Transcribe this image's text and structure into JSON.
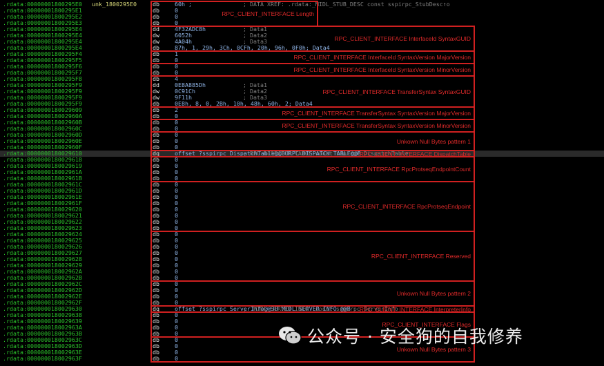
{
  "colors": {
    "background": "#000000",
    "address": "#2bc22b",
    "annotation": "#e02a2a",
    "box": "#d02020"
  },
  "lines": [
    {
      "addr": ".rdata:00000001800295E0",
      "label": "unk_1800295E0",
      "mnem": "db",
      "operand": "60h ;",
      "comment": "; DATA XREF: .rdata:_MIDL_STUB_DESC const sspirpc_StubDesc↑o"
    },
    {
      "addr": ".rdata:00000001800295E1",
      "mnem": "db",
      "operand": "0"
    },
    {
      "addr": ".rdata:00000001800295E2",
      "mnem": "db",
      "operand": "0"
    },
    {
      "addr": ".rdata:00000001800295E3",
      "mnem": "db",
      "operand": "0"
    },
    {
      "addr": ".rdata:00000001800295E4",
      "mnem": "dd",
      "operand": "4F32ADC8h",
      "comment": "; Data1"
    },
    {
      "addr": ".rdata:00000001800295E4",
      "mnem": "dw",
      "operand": "6052h",
      "comment": "; Data2"
    },
    {
      "addr": ".rdata:00000001800295E4",
      "mnem": "dw",
      "operand": "4A04h",
      "comment": "; Data3"
    },
    {
      "addr": ".rdata:00000001800295E4",
      "mnem": "db",
      "operand": "87h, 1, 29h, 3Ch, 0CFh, 20h, 96h, 0F0h; Data4"
    },
    {
      "addr": ".rdata:00000001800295F4",
      "mnem": "db",
      "operand": "1"
    },
    {
      "addr": ".rdata:00000001800295F5",
      "mnem": "db",
      "operand": "0"
    },
    {
      "addr": ".rdata:00000001800295F6",
      "mnem": "db",
      "operand": "0"
    },
    {
      "addr": ".rdata:00000001800295F7",
      "mnem": "db",
      "operand": "0"
    },
    {
      "addr": ".rdata:00000001800295F8",
      "mnem": "db",
      "operand": "4"
    },
    {
      "addr": ".rdata:00000001800295F9",
      "mnem": "dd",
      "operand": "0E8A885Dh",
      "comment": "; Data1"
    },
    {
      "addr": ".rdata:00000001800295F9",
      "mnem": "dw",
      "operand": "0C91Ch",
      "comment": "; Data2"
    },
    {
      "addr": ".rdata:00000001800295F9",
      "mnem": "dw",
      "operand": "9F11h",
      "comment": "; Data3"
    },
    {
      "addr": ".rdata:00000001800295F9",
      "mnem": "db",
      "operand": "0E8h, 8, 0, 2Bh, 10h, 48h, 60h, 2; Data4"
    },
    {
      "addr": ".rdata:0000000180029609",
      "mnem": "db",
      "operand": "2"
    },
    {
      "addr": ".rdata:000000018002960A",
      "mnem": "db",
      "operand": "0"
    },
    {
      "addr": ".rdata:000000018002960B",
      "mnem": "db",
      "operand": "0"
    },
    {
      "addr": ".rdata:000000018002960C",
      "mnem": "db",
      "operand": "0"
    },
    {
      "addr": ".rdata:000000018002960D",
      "mnem": "db",
      "operand": "0"
    },
    {
      "addr": ".rdata:000000018002960E",
      "mnem": "db",
      "operand": "0"
    },
    {
      "addr": ".rdata:000000018002960F",
      "mnem": "db",
      "operand": "0"
    },
    {
      "addr": ".rdata:0000000180029610",
      "mnem": "dq",
      "operand": "offset ?sspirpc_DispatchTable@@3URPC_DISPATCH_TABLE@@B",
      "comment": "; RPC_DISPATCH_TABLE const sspirpc_DispatchTable",
      "highlight": true
    },
    {
      "addr": ".rdata:0000000180029618",
      "mnem": "db",
      "operand": "0"
    },
    {
      "addr": ".rdata:0000000180029619",
      "mnem": "db",
      "operand": "0"
    },
    {
      "addr": ".rdata:000000018002961A",
      "mnem": "db",
      "operand": "0"
    },
    {
      "addr": ".rdata:000000018002961B",
      "mnem": "db",
      "operand": "0"
    },
    {
      "addr": ".rdata:000000018002961C",
      "mnem": "db",
      "operand": "0"
    },
    {
      "addr": ".rdata:000000018002961D",
      "mnem": "db",
      "operand": "0"
    },
    {
      "addr": ".rdata:000000018002961E",
      "mnem": "db",
      "operand": "0"
    },
    {
      "addr": ".rdata:000000018002961F",
      "mnem": "db",
      "operand": "0"
    },
    {
      "addr": ".rdata:0000000180029620",
      "mnem": "db",
      "operand": "0"
    },
    {
      "addr": ".rdata:0000000180029621",
      "mnem": "db",
      "operand": "0"
    },
    {
      "addr": ".rdata:0000000180029622",
      "mnem": "db",
      "operand": "0"
    },
    {
      "addr": ".rdata:0000000180029623",
      "mnem": "db",
      "operand": "0"
    },
    {
      "addr": ".rdata:0000000180029624",
      "mnem": "db",
      "operand": "0"
    },
    {
      "addr": ".rdata:0000000180029625",
      "mnem": "db",
      "operand": "0"
    },
    {
      "addr": ".rdata:0000000180029626",
      "mnem": "db",
      "operand": "0"
    },
    {
      "addr": ".rdata:0000000180029627",
      "mnem": "db",
      "operand": "0"
    },
    {
      "addr": ".rdata:0000000180029628",
      "mnem": "db",
      "operand": "0"
    },
    {
      "addr": ".rdata:0000000180029629",
      "mnem": "db",
      "operand": "0"
    },
    {
      "addr": ".rdata:000000018002962A",
      "mnem": "db",
      "operand": "0"
    },
    {
      "addr": ".rdata:000000018002962B",
      "mnem": "db",
      "operand": "0"
    },
    {
      "addr": ".rdata:000000018002962C",
      "mnem": "db",
      "operand": "0"
    },
    {
      "addr": ".rdata:000000018002962D",
      "mnem": "db",
      "operand": "0"
    },
    {
      "addr": ".rdata:000000018002962E",
      "mnem": "db",
      "operand": "0"
    },
    {
      "addr": ".rdata:000000018002962F",
      "mnem": "db",
      "operand": "0"
    },
    {
      "addr": ".rdata:0000000180029630",
      "mnem": "dq",
      "operand": "offset ?sspirpc_ServerInfo@@3U_MIDL_SERVER_INFO_@@B",
      "comment": "; _MIDL_SERVER_INFO_ const sspirpc_ServerInfo"
    },
    {
      "addr": ".rdata:0000000180029638",
      "mnem": "db",
      "operand": "0"
    },
    {
      "addr": ".rdata:0000000180029639",
      "mnem": "db",
      "operand": "0"
    },
    {
      "addr": ".rdata:000000018002963A",
      "mnem": "db",
      "operand": "0"
    },
    {
      "addr": ".rdata:000000018002963B",
      "mnem": "db",
      "operand": "0"
    },
    {
      "addr": ".rdata:000000018002963C",
      "mnem": "db",
      "operand": "0"
    },
    {
      "addr": ".rdata:000000018002963D",
      "mnem": "db",
      "operand": "0"
    },
    {
      "addr": ".rdata:000000018002963E",
      "mnem": "db",
      "operand": "0"
    },
    {
      "addr": ".rdata:000000018002963F",
      "mnem": "db",
      "operand": "0"
    }
  ],
  "annotations": [
    {
      "from": 0,
      "to": 3,
      "text": "RPC_CLIENT_INTERFACE Length"
    },
    {
      "from": 4,
      "to": 7,
      "text": "RPC_CLIENT_INTERFACE InterfaceId SyntaxGUID"
    },
    {
      "from": 8,
      "to": 9,
      "text": "RPC_CLIENT_INTERFACE InterfaceId SyntaxVersion MajorVersion"
    },
    {
      "from": 10,
      "to": 11,
      "text": "RPC_CLIENT_INTERFACE InterfaceId SyntaxVersion MinorVersion"
    },
    {
      "from": 12,
      "to": 16,
      "text": "RPC_CLIENT_INTERFACE TransferSyntax SyntaxGUID"
    },
    {
      "from": 17,
      "to": 18,
      "text": "RPC_CLIENT_INTERFACE TransferSyntax SyntaxVersion MajorVersion"
    },
    {
      "from": 19,
      "to": 20,
      "text": "RPC_CLIENT_INTERFACE TransferSyntax SyntaxVersion MinorVersion"
    },
    {
      "from": 21,
      "to": 23,
      "text": "Unkown Null Bytes pattern 1"
    },
    {
      "from": 24,
      "to": 24,
      "text": "RPC_CLIENT_INTERFACE DispatchTable"
    },
    {
      "from": 25,
      "to": 28,
      "text": "RPC_CLIENT_INTERFACE RpcProtseqEndpointCount"
    },
    {
      "from": 29,
      "to": 36,
      "text": "RPC_CLIENT_INTERFACE RpcProtseqEndpoint"
    },
    {
      "from": 37,
      "to": 44,
      "text": "RPC_CLIENT_INTERFACE Reserved"
    },
    {
      "from": 45,
      "to": 48,
      "text": "Unkown Null Bytes pattern 2"
    },
    {
      "from": 49,
      "to": 49,
      "text": "RPC_CLIENT_INTERFACE InterpreterInfo"
    },
    {
      "from": 50,
      "to": 53,
      "text": "RPC_CLIENT_INTERFACE Flags"
    },
    {
      "from": 54,
      "to": 57,
      "text": "Unkown Null Bytes pattern 3"
    }
  ],
  "watermark": {
    "icon": "wechat-icon",
    "text": "公众号 · 安全狗的自我修养"
  }
}
